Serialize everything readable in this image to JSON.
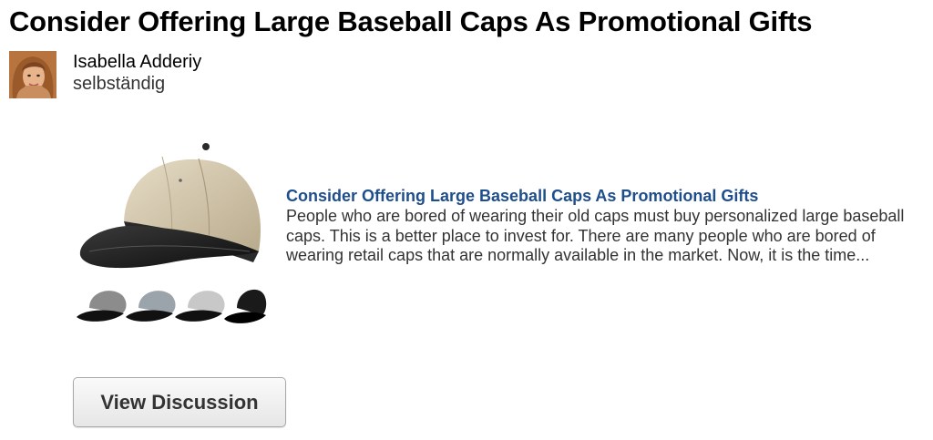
{
  "header": {
    "title": "Consider Offering Large Baseball Caps As Promotional Gifts"
  },
  "author": {
    "name": "Isabella Adderiy",
    "subtitle": "selbständig"
  },
  "article": {
    "link_title": "Consider Offering Large Baseball Caps As Promotional Gifts",
    "excerpt": "People who are bored of wearing their old caps must buy personalized large baseball caps. This is a better place to invest for. There are many people who are bored of wearing retail caps that are normally available in the market. Now, it is the time..."
  },
  "actions": {
    "view_discussion_label": "View Discussion"
  },
  "colors": {
    "link": "#1f4e8c",
    "cap_crown": "#d8cdb6",
    "cap_brim": "#1c1c1c"
  },
  "icons": {
    "avatar": "profile-photo",
    "hero": "baseball-caps-image"
  }
}
